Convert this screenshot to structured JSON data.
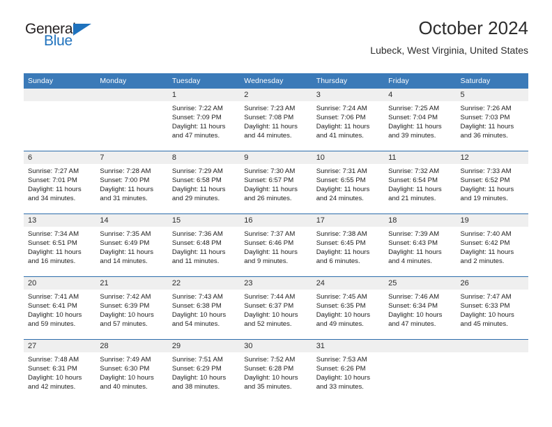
{
  "brand": {
    "name_top": "General",
    "name_bottom": "Blue",
    "accent_color": "#1f72bd",
    "triangle_icon": "triangle-icon"
  },
  "header": {
    "title": "October 2024",
    "subtitle": "Lubeck, West Virginia, United States"
  },
  "theme": {
    "header_blue": "#3b7ab8",
    "row_rule_blue": "#2c6cab",
    "daynum_strip_gray": "#efefef"
  },
  "calendar": {
    "weekday_headers": [
      "Sunday",
      "Monday",
      "Tuesday",
      "Wednesday",
      "Thursday",
      "Friday",
      "Saturday"
    ],
    "weeks": [
      [
        {
          "day": "",
          "sunrise": "",
          "sunset": "",
          "daylight_1": "",
          "daylight_2": ""
        },
        {
          "day": "",
          "sunrise": "",
          "sunset": "",
          "daylight_1": "",
          "daylight_2": ""
        },
        {
          "day": "1",
          "sunrise": "Sunrise: 7:22 AM",
          "sunset": "Sunset: 7:09 PM",
          "daylight_1": "Daylight: 11 hours",
          "daylight_2": "and 47 minutes."
        },
        {
          "day": "2",
          "sunrise": "Sunrise: 7:23 AM",
          "sunset": "Sunset: 7:08 PM",
          "daylight_1": "Daylight: 11 hours",
          "daylight_2": "and 44 minutes."
        },
        {
          "day": "3",
          "sunrise": "Sunrise: 7:24 AM",
          "sunset": "Sunset: 7:06 PM",
          "daylight_1": "Daylight: 11 hours",
          "daylight_2": "and 41 minutes."
        },
        {
          "day": "4",
          "sunrise": "Sunrise: 7:25 AM",
          "sunset": "Sunset: 7:04 PM",
          "daylight_1": "Daylight: 11 hours",
          "daylight_2": "and 39 minutes."
        },
        {
          "day": "5",
          "sunrise": "Sunrise: 7:26 AM",
          "sunset": "Sunset: 7:03 PM",
          "daylight_1": "Daylight: 11 hours",
          "daylight_2": "and 36 minutes."
        }
      ],
      [
        {
          "day": "6",
          "sunrise": "Sunrise: 7:27 AM",
          "sunset": "Sunset: 7:01 PM",
          "daylight_1": "Daylight: 11 hours",
          "daylight_2": "and 34 minutes."
        },
        {
          "day": "7",
          "sunrise": "Sunrise: 7:28 AM",
          "sunset": "Sunset: 7:00 PM",
          "daylight_1": "Daylight: 11 hours",
          "daylight_2": "and 31 minutes."
        },
        {
          "day": "8",
          "sunrise": "Sunrise: 7:29 AM",
          "sunset": "Sunset: 6:58 PM",
          "daylight_1": "Daylight: 11 hours",
          "daylight_2": "and 29 minutes."
        },
        {
          "day": "9",
          "sunrise": "Sunrise: 7:30 AM",
          "sunset": "Sunset: 6:57 PM",
          "daylight_1": "Daylight: 11 hours",
          "daylight_2": "and 26 minutes."
        },
        {
          "day": "10",
          "sunrise": "Sunrise: 7:31 AM",
          "sunset": "Sunset: 6:55 PM",
          "daylight_1": "Daylight: 11 hours",
          "daylight_2": "and 24 minutes."
        },
        {
          "day": "11",
          "sunrise": "Sunrise: 7:32 AM",
          "sunset": "Sunset: 6:54 PM",
          "daylight_1": "Daylight: 11 hours",
          "daylight_2": "and 21 minutes."
        },
        {
          "day": "12",
          "sunrise": "Sunrise: 7:33 AM",
          "sunset": "Sunset: 6:52 PM",
          "daylight_1": "Daylight: 11 hours",
          "daylight_2": "and 19 minutes."
        }
      ],
      [
        {
          "day": "13",
          "sunrise": "Sunrise: 7:34 AM",
          "sunset": "Sunset: 6:51 PM",
          "daylight_1": "Daylight: 11 hours",
          "daylight_2": "and 16 minutes."
        },
        {
          "day": "14",
          "sunrise": "Sunrise: 7:35 AM",
          "sunset": "Sunset: 6:49 PM",
          "daylight_1": "Daylight: 11 hours",
          "daylight_2": "and 14 minutes."
        },
        {
          "day": "15",
          "sunrise": "Sunrise: 7:36 AM",
          "sunset": "Sunset: 6:48 PM",
          "daylight_1": "Daylight: 11 hours",
          "daylight_2": "and 11 minutes."
        },
        {
          "day": "16",
          "sunrise": "Sunrise: 7:37 AM",
          "sunset": "Sunset: 6:46 PM",
          "daylight_1": "Daylight: 11 hours",
          "daylight_2": "and 9 minutes."
        },
        {
          "day": "17",
          "sunrise": "Sunrise: 7:38 AM",
          "sunset": "Sunset: 6:45 PM",
          "daylight_1": "Daylight: 11 hours",
          "daylight_2": "and 6 minutes."
        },
        {
          "day": "18",
          "sunrise": "Sunrise: 7:39 AM",
          "sunset": "Sunset: 6:43 PM",
          "daylight_1": "Daylight: 11 hours",
          "daylight_2": "and 4 minutes."
        },
        {
          "day": "19",
          "sunrise": "Sunrise: 7:40 AM",
          "sunset": "Sunset: 6:42 PM",
          "daylight_1": "Daylight: 11 hours",
          "daylight_2": "and 2 minutes."
        }
      ],
      [
        {
          "day": "20",
          "sunrise": "Sunrise: 7:41 AM",
          "sunset": "Sunset: 6:41 PM",
          "daylight_1": "Daylight: 10 hours",
          "daylight_2": "and 59 minutes."
        },
        {
          "day": "21",
          "sunrise": "Sunrise: 7:42 AM",
          "sunset": "Sunset: 6:39 PM",
          "daylight_1": "Daylight: 10 hours",
          "daylight_2": "and 57 minutes."
        },
        {
          "day": "22",
          "sunrise": "Sunrise: 7:43 AM",
          "sunset": "Sunset: 6:38 PM",
          "daylight_1": "Daylight: 10 hours",
          "daylight_2": "and 54 minutes."
        },
        {
          "day": "23",
          "sunrise": "Sunrise: 7:44 AM",
          "sunset": "Sunset: 6:37 PM",
          "daylight_1": "Daylight: 10 hours",
          "daylight_2": "and 52 minutes."
        },
        {
          "day": "24",
          "sunrise": "Sunrise: 7:45 AM",
          "sunset": "Sunset: 6:35 PM",
          "daylight_1": "Daylight: 10 hours",
          "daylight_2": "and 49 minutes."
        },
        {
          "day": "25",
          "sunrise": "Sunrise: 7:46 AM",
          "sunset": "Sunset: 6:34 PM",
          "daylight_1": "Daylight: 10 hours",
          "daylight_2": "and 47 minutes."
        },
        {
          "day": "26",
          "sunrise": "Sunrise: 7:47 AM",
          "sunset": "Sunset: 6:33 PM",
          "daylight_1": "Daylight: 10 hours",
          "daylight_2": "and 45 minutes."
        }
      ],
      [
        {
          "day": "27",
          "sunrise": "Sunrise: 7:48 AM",
          "sunset": "Sunset: 6:31 PM",
          "daylight_1": "Daylight: 10 hours",
          "daylight_2": "and 42 minutes."
        },
        {
          "day": "28",
          "sunrise": "Sunrise: 7:49 AM",
          "sunset": "Sunset: 6:30 PM",
          "daylight_1": "Daylight: 10 hours",
          "daylight_2": "and 40 minutes."
        },
        {
          "day": "29",
          "sunrise": "Sunrise: 7:51 AM",
          "sunset": "Sunset: 6:29 PM",
          "daylight_1": "Daylight: 10 hours",
          "daylight_2": "and 38 minutes."
        },
        {
          "day": "30",
          "sunrise": "Sunrise: 7:52 AM",
          "sunset": "Sunset: 6:28 PM",
          "daylight_1": "Daylight: 10 hours",
          "daylight_2": "and 35 minutes."
        },
        {
          "day": "31",
          "sunrise": "Sunrise: 7:53 AM",
          "sunset": "Sunset: 6:26 PM",
          "daylight_1": "Daylight: 10 hours",
          "daylight_2": "and 33 minutes."
        },
        {
          "day": "",
          "sunrise": "",
          "sunset": "",
          "daylight_1": "",
          "daylight_2": ""
        },
        {
          "day": "",
          "sunrise": "",
          "sunset": "",
          "daylight_1": "",
          "daylight_2": ""
        }
      ]
    ]
  }
}
